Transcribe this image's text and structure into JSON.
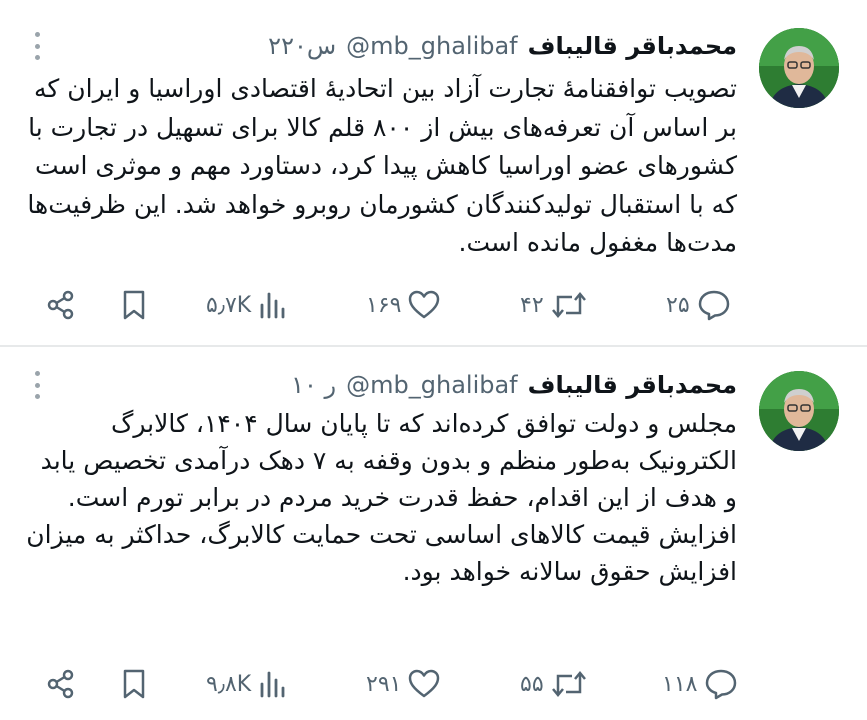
{
  "tweets": [
    {
      "author_name": "محمدباقر قالیباف",
      "handle": "@mb_ghalibaf",
      "time": "۲۲۰س",
      "paragraphs": [
        "تصویب توافقنامهٔ تجارت آزاد بین اتحادیهٔ اقتصادی اوراسیا و ایران که بر اساس آن تعرفه‌های بیش از ۸۰۰ قلم کالا برای تسهیل در تجارت با کشورهای عضو اوراسیا کاهش پیدا کرد، دستاورد مهم و موثری است که با استقبال تولیدکنندگان کشورمان روبرو خواهد شد. این ظرفیت‌ها مدت‌ها مغفول مانده است."
      ],
      "replies": "۲۵",
      "retweets": "۴۲",
      "likes": "۱۶۹",
      "views": "۵٫۷K"
    },
    {
      "author_name": "محمدباقر قالیباف",
      "handle": "@mb_ghalibaf",
      "time": "۱۰ ر",
      "paragraphs": [
        "مجلس و دولت توافق کرده‌اند که تا پایان سال ۱۴۰۴، کالابرگ الکترونیک به‌طور منظم و بدون وقفه به ۷ دهک درآمدی تخصیص یابد و هدف از این اقدام، حفظ قدرت خرید مردم در برابر تورم است.",
        "افزایش قیمت کالاهای اساسی تحت حمایت کالابرگ، حداکثر به میزان افزایش حقوق سالانه خواهد بود."
      ],
      "replies": "۱۱۸",
      "retweets": "۵۵",
      "likes": "۲۹۱",
      "views": "۹٫۸K"
    }
  ],
  "icons": {
    "reply": "reply-icon",
    "retweet": "retweet-icon",
    "like": "heart-icon",
    "views": "views-icon",
    "bookmark": "bookmark-icon",
    "share": "share-icon",
    "more": "more-icon"
  },
  "colors": {
    "text": "#0f1419",
    "muted": "#536471",
    "avatar_bg": "#2e7d32",
    "separator": "#e7e9ea"
  }
}
